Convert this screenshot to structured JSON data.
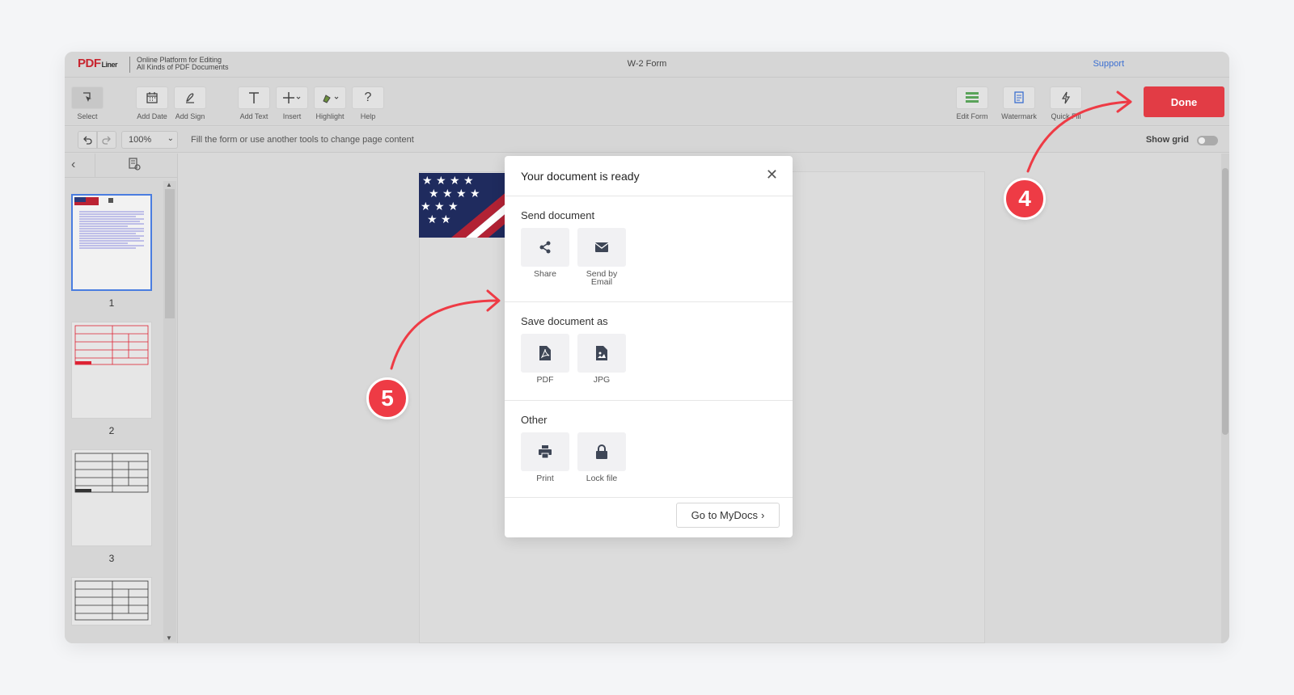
{
  "app": {
    "logo_main": "PDF",
    "logo_sub": "Liner",
    "tagline_line1": "Online Platform for Editing",
    "tagline_line2": "All Kinds of PDF Documents",
    "doc_title": "W-2 Form",
    "support_label": "Support"
  },
  "toolbar": {
    "select": "Select",
    "add_date": "Add Date",
    "add_sign": "Add Sign",
    "add_text": "Add Text",
    "insert": "Insert",
    "highlight": "Highlight",
    "help": "Help",
    "edit_form": "Edit Form",
    "watermark": "Watermark",
    "quick_fill": "Quick Fill",
    "done": "Done"
  },
  "subbar": {
    "zoom": "100%",
    "hint": "Fill the form or use another tools to change page content",
    "show_grid": "Show grid"
  },
  "sidebar": {
    "pages": [
      "1",
      "2",
      "3"
    ]
  },
  "modal": {
    "title": "Your document is ready",
    "send_title": "Send document",
    "share": "Share",
    "send_email_1": "Send by",
    "send_email_2": "Email",
    "save_title": "Save document as",
    "pdf": "PDF",
    "jpg": "JPG",
    "other_title": "Other",
    "print": "Print",
    "lock": "Lock file",
    "mydocs": "Go to MyDocs"
  },
  "annotations": {
    "step4": "4",
    "step5": "5"
  },
  "colors": {
    "done": "#e23c45",
    "badge": "#ee3b45",
    "support": "#3b6fd1",
    "selected_thumb": "#4a7de0"
  }
}
